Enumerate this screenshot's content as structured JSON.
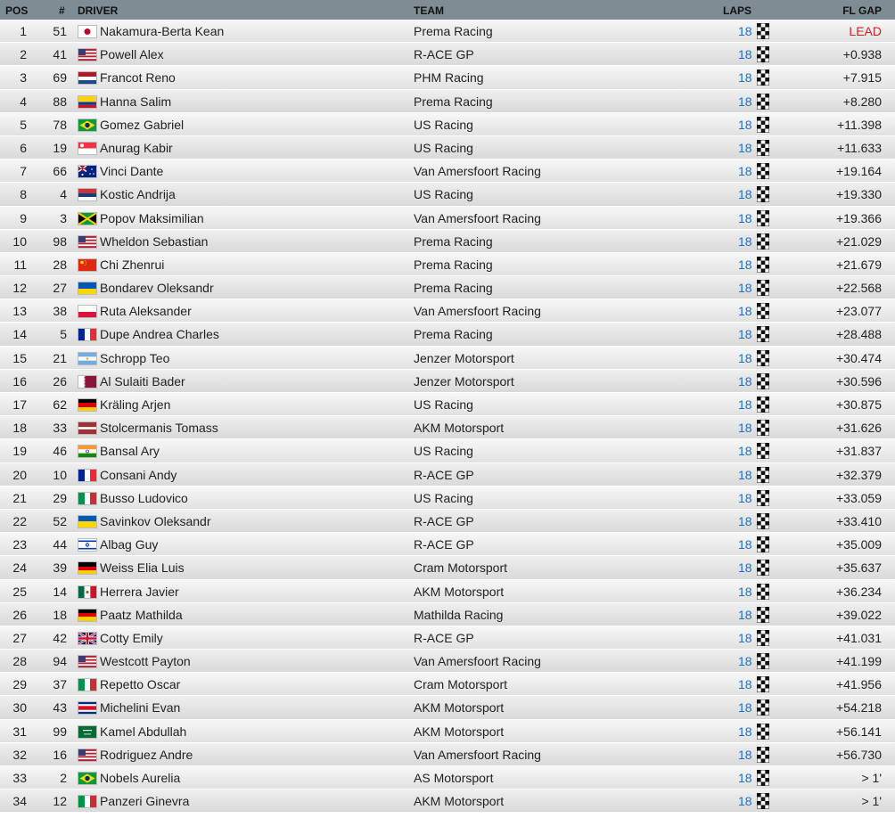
{
  "header": {
    "pos": "POS",
    "num": "#",
    "driver": "DRIVER",
    "team": "TEAM",
    "laps": "LAPS",
    "gap": "FL GAP"
  },
  "colors": {
    "header_bg": "#7d8d93",
    "laps_text": "#1a6fd1",
    "lead_text": "#d51e1e"
  },
  "rows": [
    {
      "pos": "1",
      "num": "51",
      "flag": "japan-flag",
      "driver": "Nakamura-Berta Kean",
      "team": "Prema Racing",
      "laps": "18",
      "gap": "LEAD"
    },
    {
      "pos": "2",
      "num": "41",
      "flag": "usa-flag",
      "driver": "Powell Alex",
      "team": "R-ACE GP",
      "laps": "18",
      "gap": "+0.938"
    },
    {
      "pos": "3",
      "num": "69",
      "flag": "netherlands-flag",
      "driver": "Francot Reno",
      "team": "PHM Racing",
      "laps": "18",
      "gap": "+7.915"
    },
    {
      "pos": "4",
      "num": "88",
      "flag": "colombia-flag",
      "driver": "Hanna Salim",
      "team": "Prema Racing",
      "laps": "18",
      "gap": "+8.280"
    },
    {
      "pos": "5",
      "num": "78",
      "flag": "brazil-flag",
      "driver": "Gomez Gabriel",
      "team": "US Racing",
      "laps": "18",
      "gap": "+11.398"
    },
    {
      "pos": "6",
      "num": "19",
      "flag": "singapore-flag",
      "driver": "Anurag Kabir",
      "team": "US Racing",
      "laps": "18",
      "gap": "+11.633"
    },
    {
      "pos": "7",
      "num": "66",
      "flag": "australia-flag",
      "driver": "Vinci Dante",
      "team": "Van Amersfoort Racing",
      "laps": "18",
      "gap": "+19.164"
    },
    {
      "pos": "8",
      "num": "4",
      "flag": "serbia-flag",
      "driver": "Kostic Andrija",
      "team": "US Racing",
      "laps": "18",
      "gap": "+19.330"
    },
    {
      "pos": "9",
      "num": "3",
      "flag": "jamaica-flag",
      "driver": "Popov Maksimilian",
      "team": "Van Amersfoort Racing",
      "laps": "18",
      "gap": "+19.366"
    },
    {
      "pos": "10",
      "num": "98",
      "flag": "usa-flag",
      "driver": "Wheldon Sebastian",
      "team": "Prema Racing",
      "laps": "18",
      "gap": "+21.029"
    },
    {
      "pos": "11",
      "num": "28",
      "flag": "china-flag",
      "driver": "Chi Zhenrui",
      "team": "Prema Racing",
      "laps": "18",
      "gap": "+21.679"
    },
    {
      "pos": "12",
      "num": "27",
      "flag": "ukraine-flag",
      "driver": "Bondarev Oleksandr",
      "team": "Prema Racing",
      "laps": "18",
      "gap": "+22.568"
    },
    {
      "pos": "13",
      "num": "38",
      "flag": "poland-flag",
      "driver": "Ruta Aleksander",
      "team": "Van Amersfoort Racing",
      "laps": "18",
      "gap": "+23.077"
    },
    {
      "pos": "14",
      "num": "5",
      "flag": "france-flag",
      "driver": "Dupe Andrea Charles",
      "team": "Prema Racing",
      "laps": "18",
      "gap": "+28.488"
    },
    {
      "pos": "15",
      "num": "21",
      "flag": "argentina-flag",
      "driver": "Schropp Teo",
      "team": "Jenzer Motorsport",
      "laps": "18",
      "gap": "+30.474"
    },
    {
      "pos": "16",
      "num": "26",
      "flag": "qatar-flag",
      "driver": "Al Sulaiti Bader",
      "team": "Jenzer Motorsport",
      "laps": "18",
      "gap": "+30.596"
    },
    {
      "pos": "17",
      "num": "62",
      "flag": "germany-flag",
      "driver": "Kräling Arjen",
      "team": "US Racing",
      "laps": "18",
      "gap": "+30.875"
    },
    {
      "pos": "18",
      "num": "33",
      "flag": "latvia-flag",
      "driver": "Stolcermanis Tomass",
      "team": "AKM Motorsport",
      "laps": "18",
      "gap": "+31.626"
    },
    {
      "pos": "19",
      "num": "46",
      "flag": "india-flag",
      "driver": "Bansal Ary",
      "team": "US Racing",
      "laps": "18",
      "gap": "+31.837"
    },
    {
      "pos": "20",
      "num": "10",
      "flag": "france-flag",
      "driver": "Consani Andy",
      "team": "R-ACE GP",
      "laps": "18",
      "gap": "+32.379"
    },
    {
      "pos": "21",
      "num": "29",
      "flag": "italy-flag",
      "driver": "Busso Ludovico",
      "team": "US Racing",
      "laps": "18",
      "gap": "+33.059"
    },
    {
      "pos": "22",
      "num": "52",
      "flag": "ukraine-flag",
      "driver": "Savinkov Oleksandr",
      "team": "R-ACE GP",
      "laps": "18",
      "gap": "+33.410"
    },
    {
      "pos": "23",
      "num": "44",
      "flag": "israel-flag",
      "driver": "Albag Guy",
      "team": "R-ACE GP",
      "laps": "18",
      "gap": "+35.009"
    },
    {
      "pos": "24",
      "num": "39",
      "flag": "germany-flag",
      "driver": "Weiss Elia Luis",
      "team": "Cram Motorsport",
      "laps": "18",
      "gap": "+35.637"
    },
    {
      "pos": "25",
      "num": "14",
      "flag": "mexico-flag",
      "driver": "Herrera Javier",
      "team": "AKM Motorsport",
      "laps": "18",
      "gap": "+36.234"
    },
    {
      "pos": "26",
      "num": "18",
      "flag": "germany-flag",
      "driver": "Paatz Mathilda",
      "team": "Mathilda Racing",
      "laps": "18",
      "gap": "+39.022"
    },
    {
      "pos": "27",
      "num": "42",
      "flag": "uk-flag",
      "driver": "Cotty Emily",
      "team": "R-ACE GP",
      "laps": "18",
      "gap": "+41.031"
    },
    {
      "pos": "28",
      "num": "94",
      "flag": "usa-flag",
      "driver": "Westcott Payton",
      "team": "Van Amersfoort Racing",
      "laps": "18",
      "gap": "+41.199"
    },
    {
      "pos": "29",
      "num": "37",
      "flag": "italy-flag",
      "driver": "Repetto Oscar",
      "team": "Cram Motorsport",
      "laps": "18",
      "gap": "+41.956"
    },
    {
      "pos": "30",
      "num": "43",
      "flag": "costa-rica-flag",
      "driver": "Michelini Evan",
      "team": "AKM Motorsport",
      "laps": "18",
      "gap": "+54.218"
    },
    {
      "pos": "31",
      "num": "99",
      "flag": "saudi-arabia-flag",
      "driver": "Kamel Abdullah",
      "team": "AKM Motorsport",
      "laps": "18",
      "gap": "+56.141"
    },
    {
      "pos": "32",
      "num": "16",
      "flag": "usa-flag",
      "driver": "Rodriguez Andre",
      "team": "Van Amersfoort Racing",
      "laps": "18",
      "gap": "+56.730"
    },
    {
      "pos": "33",
      "num": "2",
      "flag": "brazil-flag",
      "driver": "Nobels Aurelia",
      "team": "AS Motorsport",
      "laps": "18",
      "gap": "> 1'"
    },
    {
      "pos": "34",
      "num": "12",
      "flag": "italy-flag",
      "driver": "Panzeri Ginevra",
      "team": "AKM Motorsport",
      "laps": "18",
      "gap": "> 1'"
    }
  ]
}
